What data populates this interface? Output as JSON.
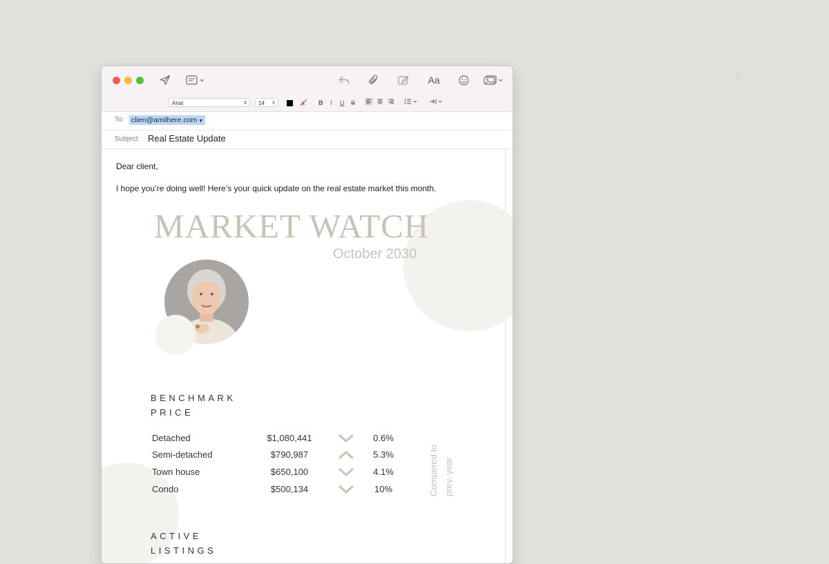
{
  "toolbar": {
    "font_name": "Arial",
    "font_size": "14",
    "text_color": "#000000",
    "icons": [
      "send-icon",
      "header-fields-icon",
      "reply-icon",
      "attachment-icon",
      "markup-icon",
      "fonts-icon",
      "emoji-icon",
      "photo-browser-icon"
    ],
    "fonts_label": "Aa",
    "bold": "B",
    "italic": "I",
    "underline": "U",
    "strike": "S"
  },
  "header": {
    "to_label": "To:",
    "to_value": "clien@amilhere.com",
    "subject_label": "Subject:",
    "subject_value": "Real Estate Update"
  },
  "body": {
    "greeting": "Dear client,",
    "intro": "I hope you’re doing well! Here’s your quick update on the real estate market this month."
  },
  "newsletter": {
    "title": "MARKET WATCH",
    "date": "October 2030",
    "accent_color": "#cbc2b6",
    "benchmark_title_line1": "BENCHMARK",
    "benchmark_title_line2": "PRICE",
    "rows": [
      {
        "name": "Detached",
        "price": "$1,080,441",
        "direction": "down",
        "percent": "0.6%"
      },
      {
        "name": "Semi-detached",
        "price": "$790,987",
        "direction": "up",
        "percent": "5.3%"
      },
      {
        "name": "Town house",
        "price": "$650,100",
        "direction": "down",
        "percent": "4.1%"
      },
      {
        "name": "Condo",
        "price": "$500,134",
        "direction": "down",
        "percent": "10%"
      }
    ],
    "compared_line1": "Compered to",
    "compared_line2": "prev. year",
    "active_title_line1": "ACTIVE",
    "active_title_line2": "LISTINGS"
  }
}
